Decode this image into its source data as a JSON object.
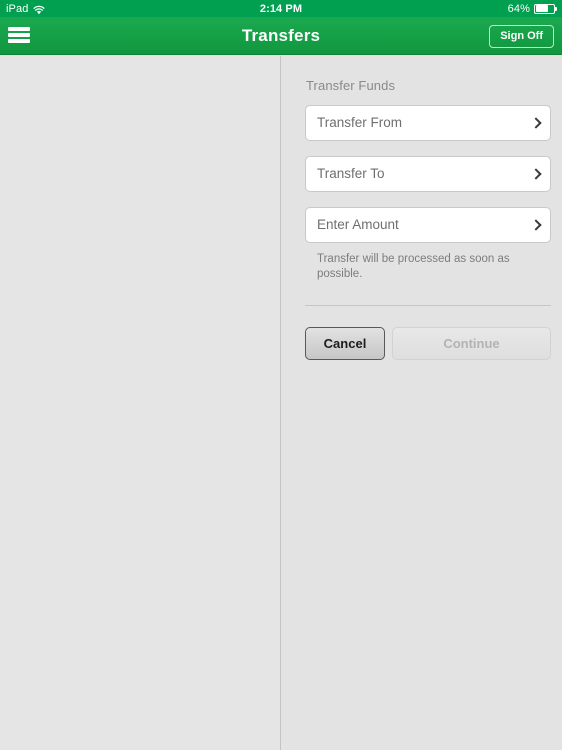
{
  "status_bar": {
    "device": "iPad",
    "wifi_icon": "wifi-icon",
    "time": "2:14 PM",
    "battery_percent": "64%",
    "battery_icon": "battery-icon"
  },
  "navbar": {
    "menu_icon": "hamburger-menu-icon",
    "title": "Transfers",
    "sign_off_label": "Sign Off"
  },
  "colors": {
    "status_bar_green": "#00a050",
    "nav_green_top": "#1ba94f",
    "nav_green_bottom": "#11973f",
    "page_background": "#e3e3e3",
    "master_background": "#e5e5e5",
    "field_background": "#ffffff",
    "muted_text": "#8a8a8a"
  },
  "detail": {
    "section_title": "Transfer Funds",
    "fields": [
      {
        "label": "Transfer From",
        "value": "",
        "chevron_icon": "chevron-right-icon"
      },
      {
        "label": "Transfer To",
        "value": "",
        "chevron_icon": "chevron-right-icon"
      },
      {
        "label": "Enter Amount",
        "value": "",
        "chevron_icon": "chevron-right-icon"
      }
    ],
    "note": "Transfer will be processed as soon as possible.",
    "buttons": {
      "cancel_label": "Cancel",
      "continue_label": "Continue",
      "continue_disabled": true
    }
  }
}
